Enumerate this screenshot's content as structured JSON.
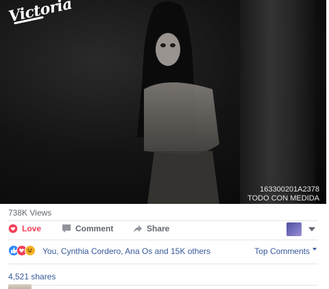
{
  "video": {
    "logo_text": "Victoria",
    "overlay_code": "163300201A2378",
    "overlay_tag": "TODO CON MEDIDA"
  },
  "stats": {
    "views": "738K Views",
    "shares": "4,521 shares"
  },
  "actions": {
    "love_label": "Love",
    "comment_label": "Comment",
    "share_label": "Share"
  },
  "reactions": {
    "text": "You, Cynthia Cordero, Ana Os and 15K others",
    "icons": [
      "like-icon",
      "love-icon",
      "haha-icon"
    ]
  },
  "sort": {
    "label": "Top Comments"
  },
  "colors": {
    "love": "#f33e58",
    "link": "#365899",
    "muted": "#616770",
    "like": "#2d88ff",
    "haha": "#f7b125"
  }
}
